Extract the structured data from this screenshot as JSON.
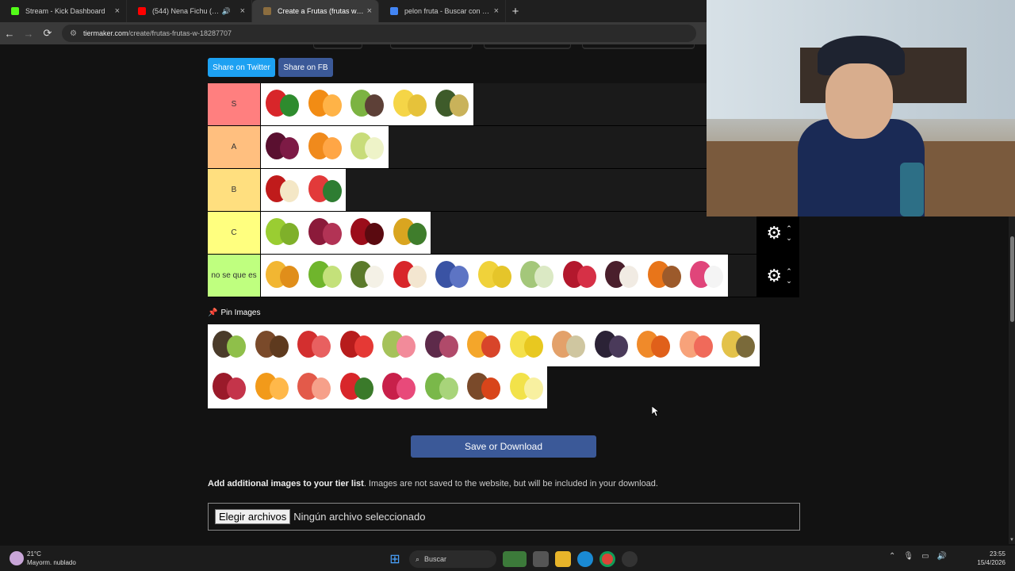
{
  "browser": {
    "tabs": [
      {
        "title": "Stream - Kick Dashboard",
        "color": "#53fc18",
        "active": false
      },
      {
        "title": "(544) Nena Fichu (Latin Tec",
        "color": "#ff0000",
        "active": false,
        "audio": "🔊"
      },
      {
        "title": "Create a Frutas (frutas w) Tier L",
        "color": "#8b6d3f",
        "active": true
      },
      {
        "title": "pelon fruta - Buscar con Googl",
        "color": "#4285f4",
        "active": false
      }
    ],
    "new_tab": "+",
    "url_host": "tiermaker.com",
    "url_path": "/create/frutas-frutas-w-18287707",
    "back": "←",
    "forward": "→",
    "reload": "⟳"
  },
  "page": {
    "share_twitter": "Share on Twitter",
    "share_fb": "Share on FB",
    "tiers": [
      {
        "label": "S",
        "color": "#ff7f7f",
        "items": [
          {
            "name": "strawberry",
            "c1": "#d8262a",
            "c2": "#2e8b2e"
          },
          {
            "name": "orange",
            "c1": "#f28c14",
            "c2": "#ffb347"
          },
          {
            "name": "kiwi",
            "c1": "#7cb342",
            "c2": "#5d4037"
          },
          {
            "name": "banana",
            "c1": "#f5d547",
            "c2": "#e6c23a"
          },
          {
            "name": "avocado",
            "c1": "#3e5b2a",
            "c2": "#c9b25a"
          }
        ]
      },
      {
        "label": "A",
        "color": "#ffbf7f",
        "items": [
          {
            "name": "plum",
            "c1": "#5a1030",
            "c2": "#7d1a45"
          },
          {
            "name": "mandarin",
            "c1": "#f08a1c",
            "c2": "#ffa646"
          },
          {
            "name": "pear",
            "c1": "#c8dc7a",
            "c2": "#eef3c8"
          }
        ]
      },
      {
        "label": "B",
        "color": "#ffdf7f",
        "items": [
          {
            "name": "apple",
            "c1": "#c01b1b",
            "c2": "#f4e7c6"
          },
          {
            "name": "watermelon",
            "c1": "#e23a3a",
            "c2": "#2e7d32"
          }
        ]
      },
      {
        "label": "C",
        "color": "#ffff7f",
        "items": [
          {
            "name": "green-grapes",
            "c1": "#9acd32",
            "c2": "#7fb02a"
          },
          {
            "name": "red-grapes",
            "c1": "#8b1a3a",
            "c2": "#b23355"
          },
          {
            "name": "cherry",
            "c1": "#9b0d1a",
            "c2": "#5a0a10"
          },
          {
            "name": "pineapple",
            "c1": "#d9a520",
            "c2": "#3f7d2c"
          }
        ]
      },
      {
        "label": "no se que es",
        "color": "#bfff7f",
        "items": [
          {
            "name": "mango",
            "c1": "#f2b632",
            "c2": "#e08e1a"
          },
          {
            "name": "lime",
            "c1": "#6fb52c",
            "c2": "#c4e17a"
          },
          {
            "name": "soursop",
            "c1": "#5b7a2b",
            "c2": "#f4f1e6"
          },
          {
            "name": "rambutan",
            "c1": "#d8262a",
            "c2": "#f3e6d0"
          },
          {
            "name": "blueberries",
            "c1": "#3a53a4",
            "c2": "#5d74c4"
          },
          {
            "name": "starfruit",
            "c1": "#f0d23a",
            "c2": "#e5c52a"
          },
          {
            "name": "sugar-apple",
            "c1": "#a4c77a",
            "c2": "#dbe9c4"
          },
          {
            "name": "raspberries",
            "c1": "#b3182d",
            "c2": "#d63046"
          },
          {
            "name": "mangosteen",
            "c1": "#4a1f2c",
            "c2": "#f1ebe3"
          },
          {
            "name": "mamey",
            "c1": "#e8751a",
            "c2": "#9c5a2b"
          },
          {
            "name": "dragonfruit",
            "c1": "#e0457a",
            "c2": "#f4f4f4"
          }
        ]
      }
    ],
    "controls": {
      "gear": "⚙",
      "up": "⌃",
      "down": "⌄"
    },
    "pin_images": "Pin Images",
    "pin_icon": "📌",
    "pool": [
      {
        "name": "passion-fruit",
        "c1": "#4a3b2a",
        "c2": "#8fbf4a"
      },
      {
        "name": "tamarind",
        "c1": "#7a4a2a",
        "c2": "#5e3a1e"
      },
      {
        "name": "strawberries",
        "c1": "#d32f2f",
        "c2": "#e86060"
      },
      {
        "name": "pomegranate",
        "c1": "#b71c1c",
        "c2": "#e53935"
      },
      {
        "name": "guava",
        "c1": "#a5c25a",
        "c2": "#f28b9a"
      },
      {
        "name": "fig",
        "c1": "#5d2a4a",
        "c2": "#b04a6a"
      },
      {
        "name": "mango-red",
        "c1": "#f4a62a",
        "c2": "#d8452a"
      },
      {
        "name": "lemons",
        "c1": "#f4e04a",
        "c2": "#e8c820"
      },
      {
        "name": "cantaloupe",
        "c1": "#e3a16a",
        "c2": "#cfc6a0"
      },
      {
        "name": "blackberries",
        "c1": "#2b2236",
        "c2": "#4a3a5a"
      },
      {
        "name": "papaya",
        "c1": "#f08a2a",
        "c2": "#e0601a"
      },
      {
        "name": "peach",
        "c1": "#f7a27a",
        "c2": "#f06a5a"
      },
      {
        "name": "yellow-fruit",
        "c1": "#e3c24a",
        "c2": "#7a6a3a"
      },
      {
        "name": "red-pods",
        "c1": "#9a1a2a",
        "c2": "#c4344a"
      },
      {
        "name": "oranges",
        "c1": "#f29a1a",
        "c2": "#ffb84a"
      },
      {
        "name": "grapefruit",
        "c1": "#e35a4a",
        "c2": "#f6a08a"
      },
      {
        "name": "tomatoes",
        "c1": "#d8262a",
        "c2": "#3a7a2a"
      },
      {
        "name": "pitaya-red",
        "c1": "#c8204a",
        "c2": "#e84a7a"
      },
      {
        "name": "prickly-pear",
        "c1": "#7ab84a",
        "c2": "#a8d47a"
      },
      {
        "name": "sapote",
        "c1": "#7a4a2a",
        "c2": "#d8451a"
      },
      {
        "name": "lemon",
        "c1": "#f2e24a",
        "c2": "#f8f0a0"
      }
    ],
    "save_button": "Save or Download",
    "add_images_bold": "Add additional images to your tier list",
    "add_images_rest": ". Images are not saved to the website, but will be included in your download.",
    "file_button": "Elegir archivos",
    "file_status": "Ningún archivo seleccionado"
  },
  "taskbar": {
    "temp": "21°C",
    "weather": "Mayorm. nublado",
    "search": "Buscar",
    "time": "23:55",
    "date": "15/4/2026",
    "start_icon": "⊞"
  }
}
